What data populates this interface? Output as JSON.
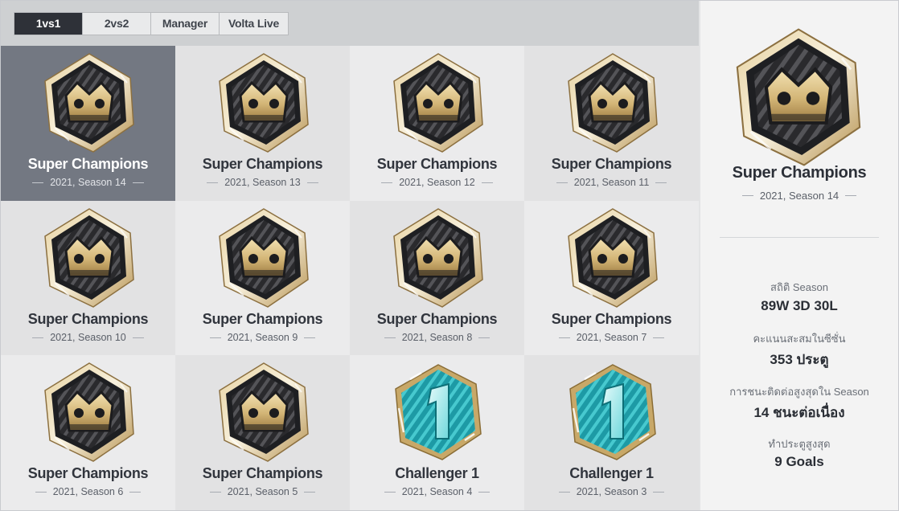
{
  "tabs": [
    {
      "label": "1vs1",
      "active": true
    },
    {
      "label": "2vs2",
      "active": false
    },
    {
      "label": "Manager",
      "active": false
    },
    {
      "label": "Volta Live",
      "active": false
    }
  ],
  "colors": {
    "selected_bg": "#737882",
    "active_tab_bg": "#2e3138",
    "gold": "#d8c08a",
    "teal": "#2ab6bf"
  },
  "grid": [
    {
      "name": "Super Champions",
      "season": "2021, Season 14",
      "badge": "super-champions-crown-icon",
      "selected": true
    },
    {
      "name": "Super Champions",
      "season": "2021, Season 13",
      "badge": "super-champions-crown-icon",
      "selected": false
    },
    {
      "name": "Super Champions",
      "season": "2021, Season 12",
      "badge": "super-champions-crown-icon",
      "selected": false
    },
    {
      "name": "Super Champions",
      "season": "2021, Season 11",
      "badge": "super-champions-crown-icon",
      "selected": false
    },
    {
      "name": "Super Champions",
      "season": "2021, Season 10",
      "badge": "super-champions-crown-icon",
      "selected": false
    },
    {
      "name": "Super Champions",
      "season": "2021, Season 9",
      "badge": "super-champions-crown-icon",
      "selected": false
    },
    {
      "name": "Super Champions",
      "season": "2021, Season 8",
      "badge": "super-champions-crown-icon",
      "selected": false
    },
    {
      "name": "Super Champions",
      "season": "2021, Season 7",
      "badge": "super-champions-crown-icon",
      "selected": false
    },
    {
      "name": "Super Champions",
      "season": "2021, Season 6",
      "badge": "super-champions-crown-icon",
      "selected": false
    },
    {
      "name": "Super Champions",
      "season": "2021, Season 5",
      "badge": "super-champions-crown-icon",
      "selected": false
    },
    {
      "name": "Challenger 1",
      "season": "2021, Season 4",
      "badge": "challenger-1-icon",
      "selected": false
    },
    {
      "name": "Challenger 1",
      "season": "2021, Season 3",
      "badge": "challenger-1-icon",
      "selected": false
    }
  ],
  "detail": {
    "name": "Super Champions",
    "season": "2021, Season 14",
    "badge": "super-champions-crown-icon",
    "stats": [
      {
        "label": "สถิติ Season",
        "value": "89W 3D 30L"
      },
      {
        "label": "คะแนนสะสมในซีซั่น",
        "value": "353 ประตู"
      },
      {
        "label": "การชนะติดต่อสูงสุดใน Season",
        "value": "14 ชนะต่อเนื่อง"
      },
      {
        "label": "ทำประตูสูงสุด",
        "value": "9 Goals"
      }
    ]
  }
}
